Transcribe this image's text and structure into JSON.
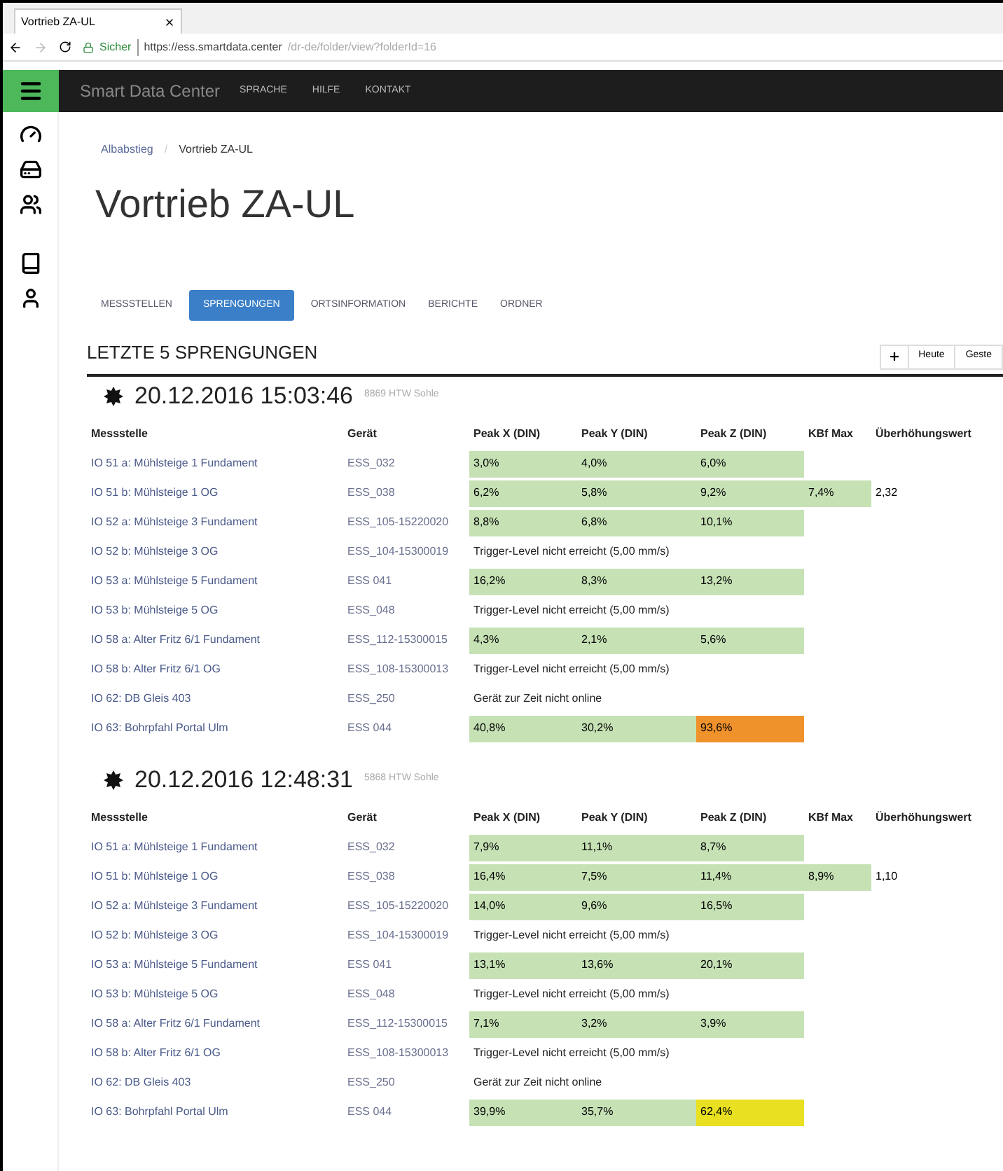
{
  "browser": {
    "tab_title": "Vortrieb ZA-UL",
    "secure_label": "Sicher",
    "url_host": "https://ess.smartdata.center",
    "url_path": "/dr-de/folder/view?folderId=16"
  },
  "navbar": {
    "brand": "Smart Data Center",
    "links": [
      "SPRACHE",
      "HILFE",
      "KONTAKT"
    ]
  },
  "breadcrumbs": [
    "Albabstieg",
    "Vortrieb ZA-UL"
  ],
  "breadcrumb_separator": "/",
  "title": "Vortrieb ZA-UL",
  "tabs": [
    {
      "label": "MESSSTELLEN",
      "selected": false
    },
    {
      "label": "SPRENGUNGEN",
      "selected": true
    },
    {
      "label": "ORTSINFORMATION",
      "selected": false
    },
    {
      "label": "BERICHTE",
      "selected": false
    },
    {
      "label": "ORDNER",
      "selected": false
    }
  ],
  "section_title": "LETZTE 5 SPRENGUNGEN",
  "toolbar": [
    "Heute",
    "Geste"
  ],
  "blasts": [
    {
      "datetime": "20.12.2016 15:03:46",
      "subtitle": "8869 HTW Sohle",
      "columns": [
        "Messstelle",
        "Gerät",
        "Peak X (DIN)",
        "Peak Y (DIN)",
        "Peak Z (DIN)",
        "KBf Max",
        "Überhöhungswert"
      ],
      "rows": [
        {
          "kind": "values",
          "station": "IO 51 a: Mühlsteige 1 Fundament",
          "device": "ESS_032",
          "peaks": [
            {
              "text": "3,0%",
              "color": "#c6e2b5"
            },
            {
              "text": "4,0%",
              "color": "#c6e2b5"
            },
            {
              "text": "6,0%",
              "color": "#c6e2b5"
            }
          ]
        },
        {
          "kind": "values",
          "station": "IO 51 b: Mühlsteige 1 OG",
          "device": "ESS_038",
          "peaks": [
            {
              "text": "6,2%",
              "color": "#c6e2b5"
            },
            {
              "text": "5,8%",
              "color": "#c6e2b5"
            },
            {
              "text": "9,2%",
              "color": "#c6e2b5"
            }
          ],
          "kbf": {
            "text": "7,4%",
            "color": "#c6e2b5"
          },
          "factor": "2,32"
        },
        {
          "kind": "values",
          "station": "IO 52 a: Mühlsteige 3 Fundament",
          "device": "ESS_105-15220020",
          "peaks": [
            {
              "text": "8,8%",
              "color": "#c6e2b5"
            },
            {
              "text": "6,8%",
              "color": "#c6e2b5"
            },
            {
              "text": "10,1%",
              "color": "#c6e2b5"
            }
          ]
        },
        {
          "kind": "message",
          "station": "IO 52 b: Mühlsteige 3 OG",
          "device": "ESS_104-15300019",
          "message": "Trigger-Level nicht erreicht (5,00 mm/s)"
        },
        {
          "kind": "values",
          "station": "IO 53 a: Mühlsteige 5 Fundament",
          "device": "ESS 041",
          "peaks": [
            {
              "text": "16,2%",
              "color": "#c6e2b5"
            },
            {
              "text": "8,3%",
              "color": "#c6e2b5"
            },
            {
              "text": "13,2%",
              "color": "#c6e2b5"
            }
          ]
        },
        {
          "kind": "message",
          "station": "IO 53 b: Mühlsteige 5 OG",
          "device": "ESS_048",
          "message": "Trigger-Level nicht erreicht (5,00 mm/s)"
        },
        {
          "kind": "values",
          "station": "IO 58 a: Alter Fritz 6/1 Fundament",
          "device": "ESS_112-15300015",
          "peaks": [
            {
              "text": "4,3%",
              "color": "#c6e2b5"
            },
            {
              "text": "2,1%",
              "color": "#c6e2b5"
            },
            {
              "text": "5,6%",
              "color": "#c6e2b5"
            }
          ]
        },
        {
          "kind": "message",
          "station": "IO 58 b: Alter Fritz 6/1 OG",
          "device": "ESS_108-15300013",
          "message": "Trigger-Level nicht erreicht (5,00 mm/s)"
        },
        {
          "kind": "message",
          "station": "IO 62: DB Gleis 403",
          "device": "ESS_250",
          "message": "Gerät zur Zeit nicht online"
        },
        {
          "kind": "values",
          "station": "IO 63: Bohrpfahl Portal Ulm",
          "device": "ESS 044",
          "peaks": [
            {
              "text": "40,8%",
              "color": "#c6e2b5"
            },
            {
              "text": "30,2%",
              "color": "#c6e2b5"
            },
            {
              "text": "93,6%",
              "color": "#f0922b"
            }
          ]
        }
      ]
    },
    {
      "datetime": "20.12.2016 12:48:31",
      "subtitle": "5868 HTW Sohle",
      "columns": [
        "Messstelle",
        "Gerät",
        "Peak X (DIN)",
        "Peak Y (DIN)",
        "Peak Z (DIN)",
        "KBf Max",
        "Überhöhungswert"
      ],
      "rows": [
        {
          "kind": "values",
          "station": "IO 51 a: Mühlsteige 1 Fundament",
          "device": "ESS_032",
          "peaks": [
            {
              "text": "7,9%",
              "color": "#c6e2b5"
            },
            {
              "text": "11,1%",
              "color": "#c6e2b5"
            },
            {
              "text": "8,7%",
              "color": "#c6e2b5"
            }
          ]
        },
        {
          "kind": "values",
          "station": "IO 51 b: Mühlsteige 1 OG",
          "device": "ESS_038",
          "peaks": [
            {
              "text": "16,4%",
              "color": "#c6e2b5"
            },
            {
              "text": "7,5%",
              "color": "#c6e2b5"
            },
            {
              "text": "11,4%",
              "color": "#c6e2b5"
            }
          ],
          "kbf": {
            "text": "8,9%",
            "color": "#c6e2b5"
          },
          "factor": "1,10"
        },
        {
          "kind": "values",
          "station": "IO 52 a: Mühlsteige 3 Fundament",
          "device": "ESS_105-15220020",
          "peaks": [
            {
              "text": "14,0%",
              "color": "#c6e2b5"
            },
            {
              "text": "9,6%",
              "color": "#c6e2b5"
            },
            {
              "text": "16,5%",
              "color": "#c6e2b5"
            }
          ]
        },
        {
          "kind": "message",
          "station": "IO 52 b: Mühlsteige 3 OG",
          "device": "ESS_104-15300019",
          "message": "Trigger-Level nicht erreicht (5,00 mm/s)"
        },
        {
          "kind": "values",
          "station": "IO 53 a: Mühlsteige 5 Fundament",
          "device": "ESS 041",
          "peaks": [
            {
              "text": "13,1%",
              "color": "#c6e2b5"
            },
            {
              "text": "13,6%",
              "color": "#c6e2b5"
            },
            {
              "text": "20,1%",
              "color": "#c6e2b5"
            }
          ]
        },
        {
          "kind": "message",
          "station": "IO 53 b: Mühlsteige 5 OG",
          "device": "ESS_048",
          "message": "Trigger-Level nicht erreicht (5,00 mm/s)"
        },
        {
          "kind": "values",
          "station": "IO 58 a: Alter Fritz 6/1 Fundament",
          "device": "ESS_112-15300015",
          "peaks": [
            {
              "text": "7,1%",
              "color": "#c6e2b5"
            },
            {
              "text": "3,2%",
              "color": "#c6e2b5"
            },
            {
              "text": "3,9%",
              "color": "#c6e2b5"
            }
          ]
        },
        {
          "kind": "message",
          "station": "IO 58 b: Alter Fritz 6/1 OG",
          "device": "ESS_108-15300013",
          "message": "Trigger-Level nicht erreicht (5,00 mm/s)"
        },
        {
          "kind": "message",
          "station": "IO 62: DB Gleis 403",
          "device": "ESS_250",
          "message": "Gerät zur Zeit nicht online"
        },
        {
          "kind": "values",
          "station": "IO 63: Bohrpfahl Portal Ulm",
          "device": "ESS 044",
          "peaks": [
            {
              "text": "39,9%",
              "color": "#c6e2b5"
            },
            {
              "text": "35,7%",
              "color": "#c6e2b5"
            },
            {
              "text": "62,4%",
              "color": "#e8e021"
            }
          ]
        }
      ]
    }
  ]
}
